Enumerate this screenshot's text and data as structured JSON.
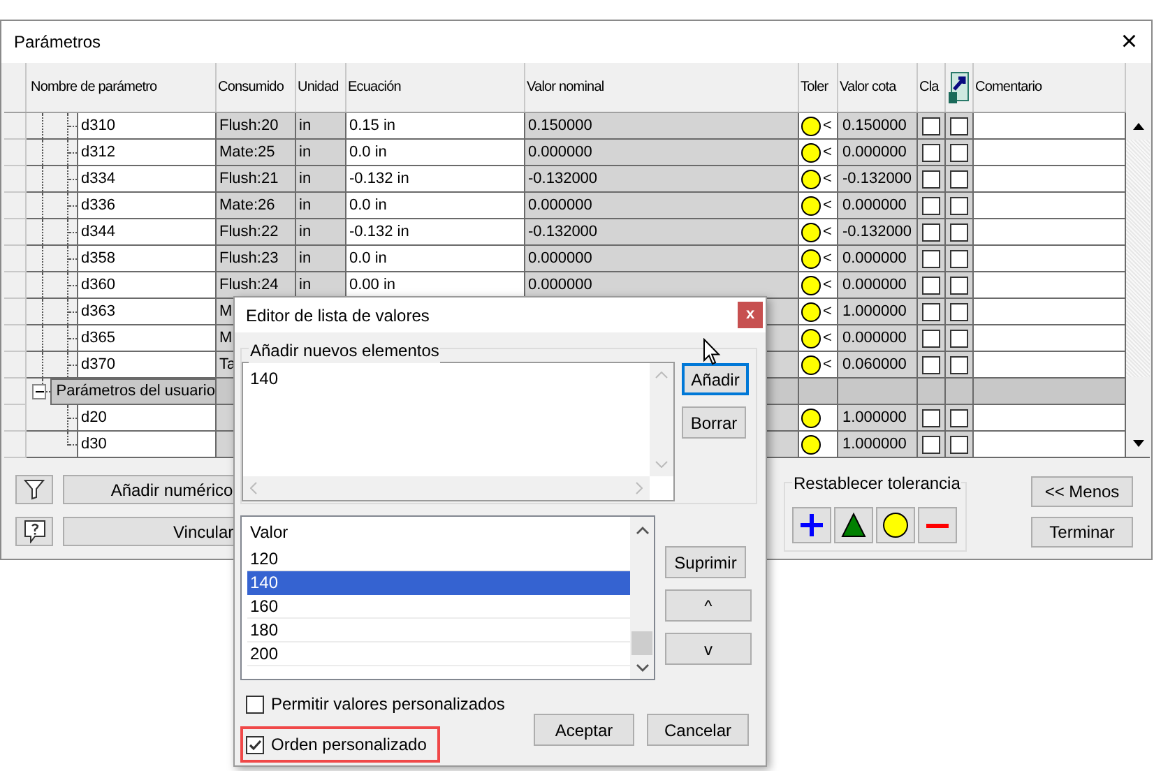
{
  "window": {
    "title": "Parámetros",
    "close": "×"
  },
  "table": {
    "columns": [
      {
        "kind": "text",
        "label": "Nombre de parámetro"
      },
      {
        "kind": "text",
        "label": "Consumido"
      },
      {
        "kind": "text",
        "label": "Unidad"
      },
      {
        "kind": "text",
        "label": "Ecuación"
      },
      {
        "kind": "text",
        "label": "Valor nominal"
      },
      {
        "kind": "text",
        "label": "Toler"
      },
      {
        "kind": "text",
        "label": "Valor cota"
      },
      {
        "kind": "text",
        "label": "Cla"
      },
      {
        "kind": "icon"
      },
      {
        "kind": "text",
        "label": "Comentario"
      }
    ],
    "rows": [
      {
        "name": "d310",
        "consumed": "Flush:20",
        "unit": "in",
        "equation": "0.15 in",
        "nominal": "0.150000",
        "tolerance_mark": "<",
        "model_value": "0.150000",
        "key": false,
        "export": false
      },
      {
        "name": "d312",
        "consumed": "Mate:25",
        "unit": "in",
        "equation": "0.0 in",
        "nominal": "0.000000",
        "tolerance_mark": "<",
        "model_value": "0.000000",
        "key": false,
        "export": false
      },
      {
        "name": "d334",
        "consumed": "Flush:21",
        "unit": "in",
        "equation": "-0.132 in",
        "nominal": "-0.132000",
        "tolerance_mark": "<",
        "model_value": "-0.132000",
        "key": false,
        "export": false
      },
      {
        "name": "d336",
        "consumed": "Mate:26",
        "unit": "in",
        "equation": "0.0 in",
        "nominal": "0.000000",
        "tolerance_mark": "<",
        "model_value": "0.000000",
        "key": false,
        "export": false
      },
      {
        "name": "d344",
        "consumed": "Flush:22",
        "unit": "in",
        "equation": "-0.132 in",
        "nominal": "-0.132000",
        "tolerance_mark": "<",
        "model_value": "-0.132000",
        "key": false,
        "export": false
      },
      {
        "name": "d358",
        "consumed": "Flush:23",
        "unit": "in",
        "equation": "0.0 in",
        "nominal": "0.000000",
        "tolerance_mark": "<",
        "model_value": "0.000000",
        "key": false,
        "export": false
      },
      {
        "name": "d360",
        "consumed": "Flush:24",
        "unit": "in",
        "equation": "0.00 in",
        "nominal": "0.000000",
        "tolerance_mark": "<",
        "model_value": "0.000000",
        "key": false,
        "export": false
      },
      {
        "name": "d363",
        "consumed": "M",
        "tolerance_mark": "<",
        "model_value": "1.000000",
        "key": false,
        "export": false
      },
      {
        "name": "d365",
        "consumed": "M",
        "tolerance_mark": "<",
        "model_value": "0.000000",
        "key": false,
        "export": false
      },
      {
        "name": "d370",
        "consumed": "Ta",
        "tolerance_mark": "<",
        "model_value": "0.060000",
        "key": false,
        "export": false
      }
    ],
    "user_group": {
      "label": "Parámetros del usuario",
      "expanded": true,
      "rows": [
        {
          "name": "d20",
          "model_value": "1.000000",
          "key": false,
          "export": false
        },
        {
          "name": "d30",
          "model_value": "1.000000",
          "key": false,
          "export": false
        }
      ]
    }
  },
  "buttons": {
    "add_numeric": "Añadir numérico",
    "link": "Vincular",
    "less": "<< Menos",
    "finish": "Terminar"
  },
  "reset_tolerance": {
    "label": "Restablecer tolerancia"
  },
  "dialog": {
    "title": "Editor de lista de valores",
    "close": "x",
    "add_group": {
      "label": "Añadir nuevos elementos",
      "value": "140"
    },
    "add_button": "Añadir",
    "clear_button": "Borrar",
    "list": {
      "header": "Valor",
      "items": [
        {
          "label": "120",
          "selected": false
        },
        {
          "label": "140",
          "selected": true
        },
        {
          "label": "160",
          "selected": false
        },
        {
          "label": "180",
          "selected": false
        },
        {
          "label": "200",
          "selected": false
        }
      ]
    },
    "delete_button": "Suprimir",
    "up_button": "^",
    "down_button": "v",
    "options": [
      {
        "label": "Permitir valores personalizados",
        "checked": false,
        "highlighted": false
      },
      {
        "label": "Orden personalizado",
        "checked": true,
        "highlighted": true
      }
    ],
    "ok_button": "Aceptar",
    "cancel_button": "Cancelar"
  }
}
